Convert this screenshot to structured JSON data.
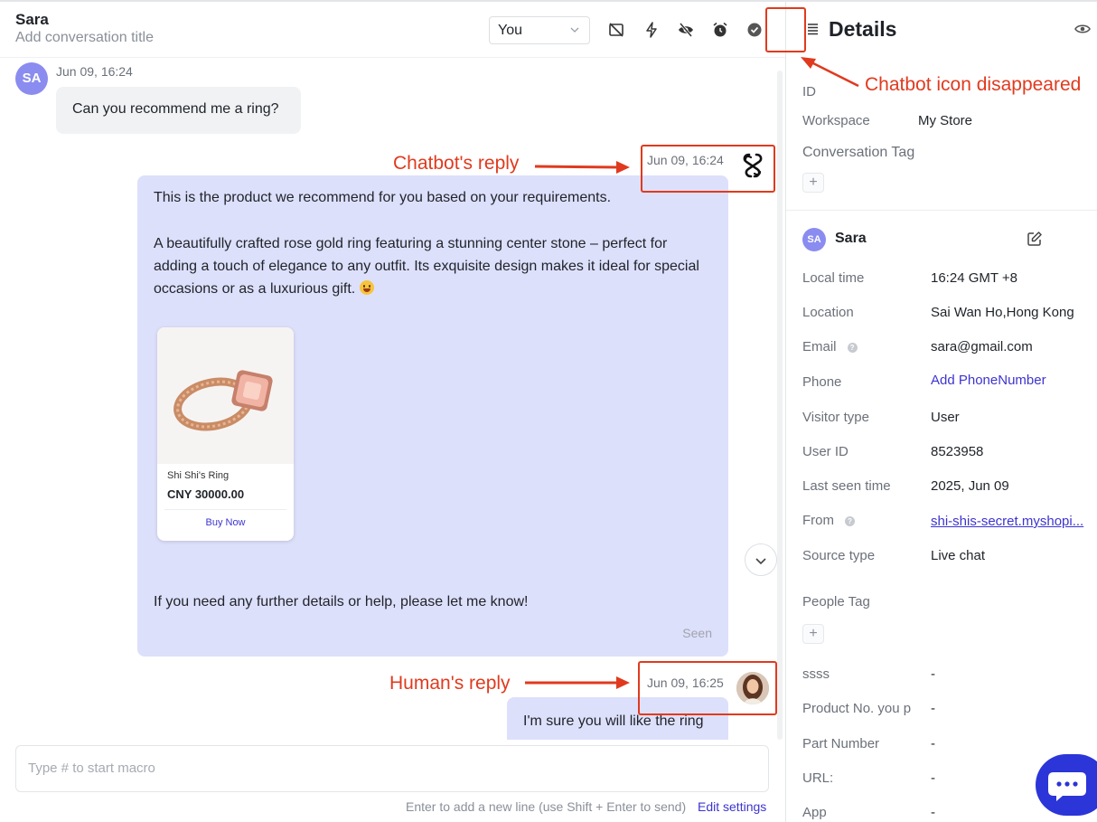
{
  "chat": {
    "name": "Sara",
    "subtitle": "Add conversation title",
    "assignee": "You",
    "messages": [
      {
        "avatar": "SA",
        "time": "Jun 09, 16:24",
        "text": "Can you recommend me a ring?"
      },
      {
        "time": "Jun 09, 16:24",
        "p1": "This is the product we recommend for you based on your requirements.",
        "p2": "A beautifully crafted rose gold ring featuring a stunning center stone – perfect for adding a touch of elegance to any outfit. Its exquisite design makes it ideal for special occasions or as a luxurious gift.",
        "p3": "If you need any further details or help, please let me know!",
        "seen": "Seen",
        "product": {
          "name": "Shi Shi's Ring",
          "price": "CNY 30000.00",
          "buy": "Buy Now"
        }
      },
      {
        "time": "Jun 09, 16:25",
        "text": "I'm sure you will like the ring"
      }
    ]
  },
  "composer": {
    "placeholder": "Type # to start macro",
    "hint": "Enter to add a new line (use Shift + Enter to send)",
    "edit_settings": "Edit settings"
  },
  "details": {
    "title": "Details",
    "id_label": "ID",
    "workspace_label": "Workspace",
    "workspace_value": "My Store",
    "conversation_tag_label": "Conversation Tag",
    "add": "+",
    "contact": {
      "avatar": "SA",
      "name": "Sara",
      "rows": [
        {
          "label": "Local time",
          "value": "16:24 GMT +8"
        },
        {
          "label": "Location",
          "value": "Sai Wan Ho,Hong Kong"
        },
        {
          "label": "Email",
          "value": "sara@gmail.com"
        },
        {
          "label": "Phone",
          "value": "Add PhoneNumber"
        },
        {
          "label": "Visitor type",
          "value": "User"
        },
        {
          "label": "User ID",
          "value": "8523958"
        },
        {
          "label": "Last seen time",
          "value": "2025, Jun 09"
        },
        {
          "label": "From",
          "value": "shi-shis-secret.myshopi..."
        },
        {
          "label": "Source type",
          "value": "Live chat"
        }
      ],
      "people_tag_label": "People Tag",
      "custom": [
        {
          "label": "ssss",
          "value": "-"
        },
        {
          "label": "Product No. you p",
          "value": "-"
        },
        {
          "label": "Part Number",
          "value": "-"
        },
        {
          "label": "URL:",
          "value": "-"
        },
        {
          "label": "App",
          "value": "-"
        }
      ]
    }
  },
  "annotations": {
    "chatbot_icon": "Chatbot icon disappeared",
    "chatbot_reply": "Chatbot's reply",
    "human_reply": "Human's reply"
  },
  "icons": {
    "header": [
      "no-video-icon",
      "lightning-icon",
      "eye-off-icon",
      "snooze-icon",
      "check-circle-icon"
    ],
    "panel": [
      "list-icon",
      "eye-icon",
      "edit-icon"
    ]
  },
  "colors": {
    "accent": "#3d34d0",
    "bubble": "#dde0fb",
    "annotation": "#e03a1e",
    "fab": "#2b35d8"
  }
}
